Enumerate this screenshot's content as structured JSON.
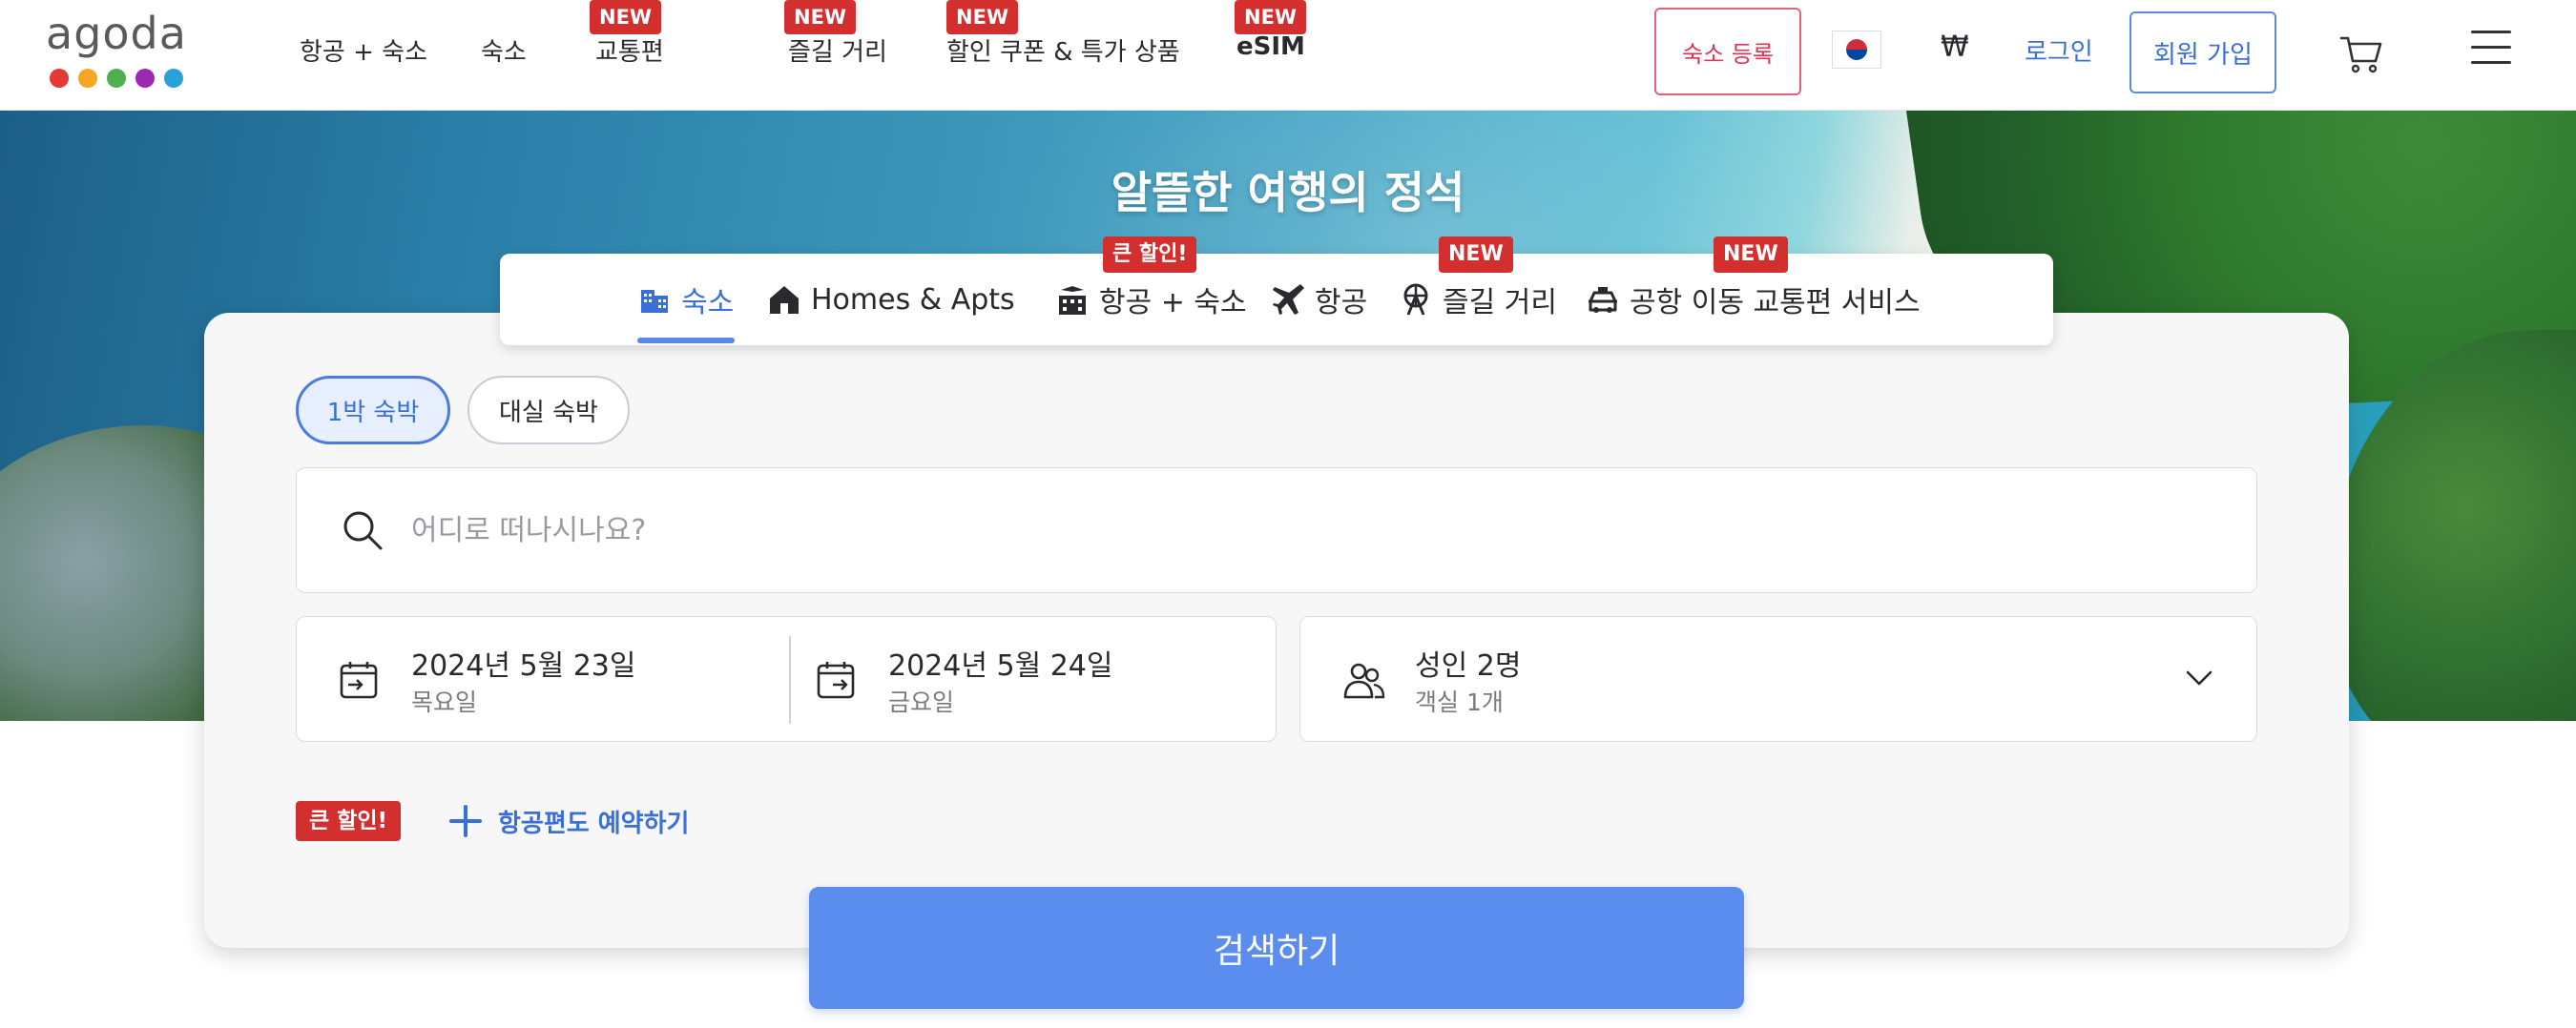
{
  "brand": {
    "logo_text": "agoda",
    "dot_colors": [
      "#e53935",
      "#f5a623",
      "#4caf50",
      "#9c27b0",
      "#2a9fd8"
    ]
  },
  "nav": {
    "items": [
      {
        "label": "항공 + 숙소",
        "badge": ""
      },
      {
        "label": "숙소",
        "badge": ""
      },
      {
        "label": "교통편",
        "badge": "NEW"
      },
      {
        "label": "즐길 거리",
        "badge": "NEW"
      },
      {
        "label": "할인 쿠폰 & 특가 상품",
        "badge": "NEW"
      },
      {
        "label": "eSIM",
        "badge": "NEW"
      }
    ],
    "register_property": "숙소 등록",
    "currency": "₩",
    "login": "로그인",
    "signup": "회원 가입"
  },
  "hero": {
    "title": "알뜰한 여행의 정석"
  },
  "search_tabs": [
    {
      "label": "숙소",
      "badge": "",
      "active": true,
      "icon": "hotel-icon"
    },
    {
      "label": "Homes & Apts",
      "badge": "",
      "active": false,
      "icon": "home-icon"
    },
    {
      "label": "항공 + 숙소",
      "badge": "큰 할인!",
      "active": false,
      "icon": "flight-hotel-icon"
    },
    {
      "label": "항공",
      "badge": "",
      "active": false,
      "icon": "airplane-icon"
    },
    {
      "label": "즐길 거리",
      "badge": "NEW",
      "active": false,
      "icon": "ferris-wheel-icon"
    },
    {
      "label": "공항 이동 교통편 서비스",
      "badge": "NEW",
      "active": false,
      "icon": "car-icon"
    }
  ],
  "stay_types": [
    {
      "label": "1박 숙박",
      "active": true
    },
    {
      "label": "대실 숙박",
      "active": false
    }
  ],
  "search": {
    "placeholder": "어디로 떠나시나요?",
    "value": ""
  },
  "dates": {
    "checkin": {
      "date": "2024년 5월 23일",
      "day": "목요일"
    },
    "checkout": {
      "date": "2024년 5월 24일",
      "day": "금요일"
    }
  },
  "guests": {
    "main": "성인 2명",
    "sub": "객실 1개"
  },
  "promo": {
    "badge": "큰 할인!",
    "add_flight": "항공편도 예약하기"
  },
  "search_button": "검색하기",
  "colors": {
    "accent": "#5b8def",
    "link": "#3a6fd8",
    "badge_red": "#d32f2f",
    "register_pink": "#e0344f"
  }
}
